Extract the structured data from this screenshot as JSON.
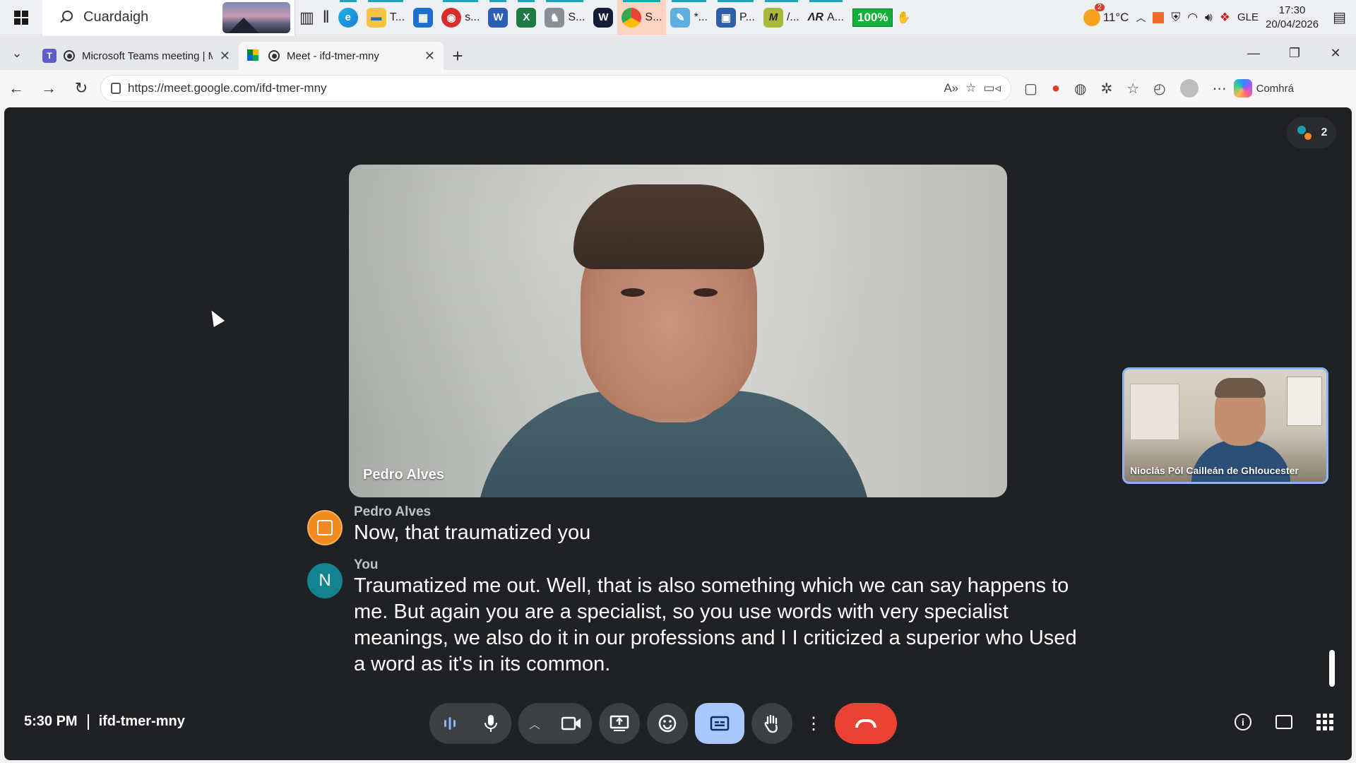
{
  "taskbar": {
    "search_placeholder": "Cuardaigh",
    "apps": [
      {
        "label": "T...",
        "icon": "file-explorer-icon"
      },
      {
        "label": "s...",
        "icon": "recording-app-icon"
      },
      {
        "label": "S...",
        "icon": "speech-app-icon"
      },
      {
        "label": "S...",
        "icon": "chrome-icon"
      },
      {
        "label": "*...",
        "icon": "notepad-icon"
      },
      {
        "label": "P...",
        "icon": "remote-desktop-icon"
      },
      {
        "label": "/...",
        "icon": "m-app-icon"
      },
      {
        "label": "A...",
        "icon": "air-app-icon"
      }
    ],
    "battery_label": "100%",
    "weather": "11°C",
    "notification_count": "2",
    "language": "GLE",
    "time": "17:30",
    "date": "20/04/2026"
  },
  "tabs": [
    {
      "title": "Microsoft Teams meeting | Mi",
      "active": false
    },
    {
      "title": "Meet - ifd-tmer-mny",
      "active": true
    }
  ],
  "address": {
    "url": "https://meet.google.com/ifd-tmer-mny",
    "copilot_label": "Comhrá"
  },
  "meet": {
    "participant_count": "2",
    "main_speaker_name": "Pedro Alves",
    "self_view_name": "Nioclás Pól Cailleán de Ghloucester",
    "captions": [
      {
        "speaker": "Pedro Alves",
        "avatar_letter": "",
        "avatar_color": "#f28b1f",
        "text": "Now, that traumatized you"
      },
      {
        "speaker": "You",
        "avatar_letter": "N",
        "avatar_color": "#12848f",
        "text": "Traumatized me out. Well, that is also something which we can say happens to me. But again you are a specialist, so you use words with very specialist meanings, we also do it in our professions and I I criticized a superior who Used a word as it's in its common."
      }
    ],
    "time": "5:30 PM",
    "meeting_code": "ifd-tmer-mny"
  },
  "colors": {
    "meet_bg": "#202124",
    "control_bg": "#3c4043",
    "captions_active": "#a8c7fa",
    "hangup": "#ea4335"
  }
}
